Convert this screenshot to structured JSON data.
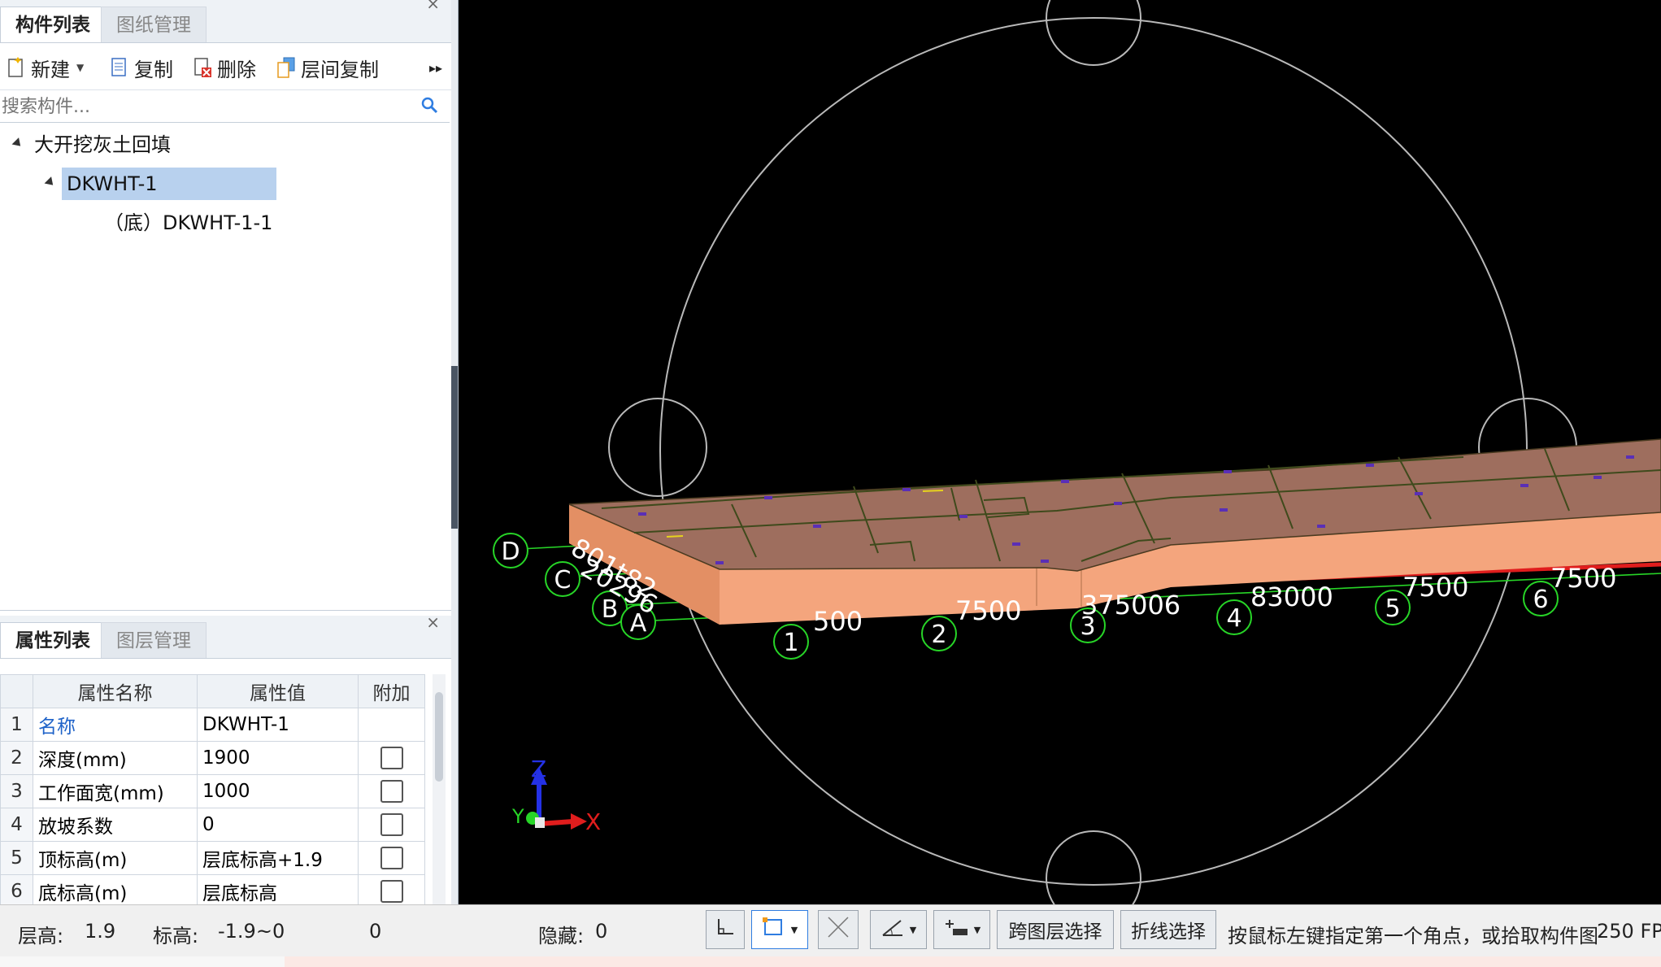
{
  "component_panel": {
    "tabs": [
      "构件列表",
      "图纸管理"
    ],
    "toolbar": {
      "new": "新建",
      "copy": "复制",
      "delete": "删除",
      "floor_copy": "层间复制"
    },
    "search_placeholder": "搜索构件...",
    "tree": {
      "root": "大开挖灰土回填",
      "child": "DKWHT-1",
      "grandchild": "（底）DKWHT-1-1"
    }
  },
  "property_panel": {
    "tabs": [
      "属性列表",
      "图层管理"
    ],
    "headers": [
      "属性名称",
      "属性值",
      "附加"
    ],
    "rows": [
      {
        "num": "1",
        "name": "名称",
        "value": "DKWHT-1"
      },
      {
        "num": "2",
        "name": "深度(mm)",
        "value": "1900"
      },
      {
        "num": "3",
        "name": "工作面宽(mm)",
        "value": "1000"
      },
      {
        "num": "4",
        "name": "放坡系数",
        "value": "0"
      },
      {
        "num": "5",
        "name": "顶标高(m)",
        "value": "层底标高+1.9"
      },
      {
        "num": "6",
        "name": "底标高(m)",
        "value": "层底标高"
      }
    ]
  },
  "viewport": {
    "axis_labels": {
      "row_d": "D",
      "row_c": "C",
      "row_b": "B",
      "row_a": "A",
      "col_1": "1",
      "col_2": "2",
      "col_3": "3",
      "col_4": "4",
      "col_5": "5",
      "col_6": "6"
    },
    "dimensions": {
      "d1": "500",
      "d2": "7500",
      "d3": "375006",
      "d4": "83000",
      "d5": "7500",
      "d6": "7500",
      "diag1": "801t82",
      "diag2": "20296"
    },
    "triad": {
      "x": "X",
      "y": "Y",
      "z": "Z"
    },
    "colors": {
      "slab_top": "#9e6e5e",
      "slab_side": "#f4a57d",
      "grid": "#27d527",
      "orbit": "#b9b9b9"
    }
  },
  "status": {
    "floor_height_label": "层高:",
    "floor_height": "1.9",
    "elevation_label": "标高:",
    "elevation": "-1.9~0",
    "count": "0",
    "hidden_label": "隐藏:",
    "hidden": "0",
    "cross_layer": "跨图层选择",
    "polyline": "折线选择",
    "hint": "按鼠标左键指定第一个角点，或拾取构件图",
    "fps": "250 FP"
  }
}
